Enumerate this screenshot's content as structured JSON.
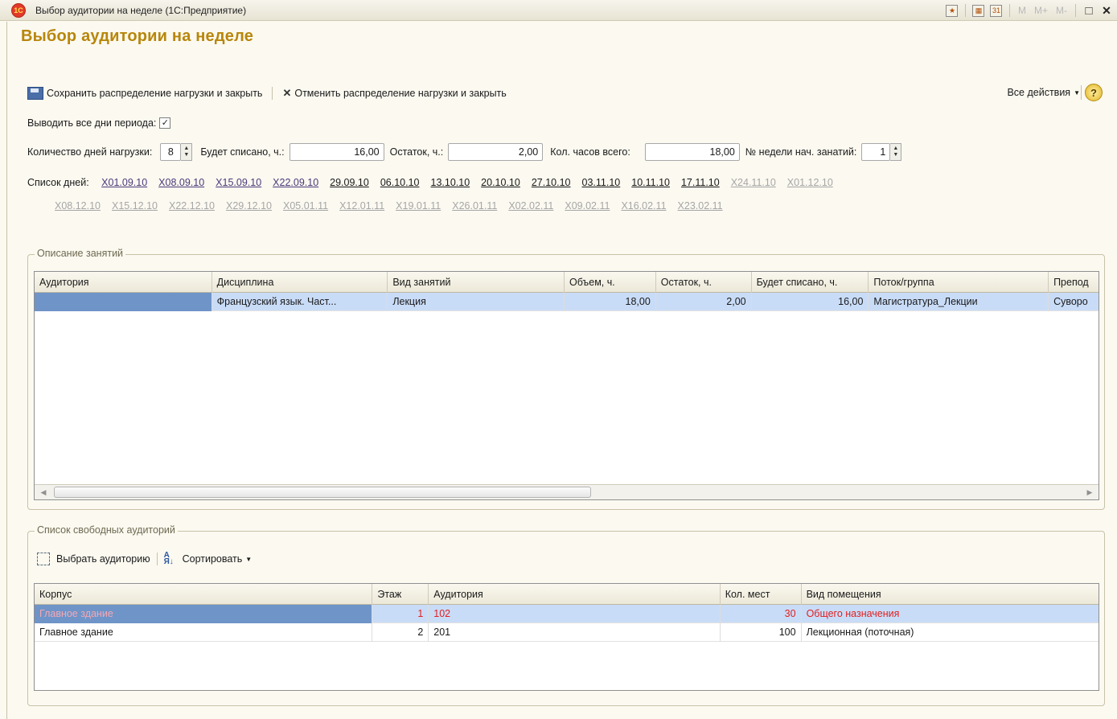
{
  "window": {
    "logo": "1C",
    "title": "Выбор аудитории на неделе  (1С:Предприятие)",
    "toolbar_m": "M",
    "toolbar_mplus": "M+",
    "toolbar_mminus": "M-",
    "close": "✕",
    "maximize": "□"
  },
  "form": {
    "title": "Выбор аудитории на неделе",
    "save_label": "Сохранить распределение нагрузки и закрыть",
    "cancel_label": "Отменить распределение нагрузки и закрыть",
    "all_actions": "Все действия",
    "help": "?"
  },
  "params": {
    "show_all_days_label": "Выводить все дни периода:",
    "show_all_days_checked": true,
    "days_count_label": "Количество дней нагрузки:",
    "days_count_value": "8",
    "will_write_label": "Будет списано, ч.:",
    "will_write_value": "16,00",
    "remainder_label": "Остаток, ч.:",
    "remainder_value": "2,00",
    "total_hours_label": "Кол. часов всего:",
    "total_hours_value": "18,00",
    "start_week_label": "№ недели нач. занатий:",
    "start_week_value": "1"
  },
  "days": {
    "label": "Список дней:",
    "line1": [
      {
        "text": "X01.09.10",
        "kind": "x"
      },
      {
        "text": "X08.09.10",
        "kind": "x"
      },
      {
        "text": "X15.09.10",
        "kind": "x"
      },
      {
        "text": "X22.09.10",
        "kind": "x"
      },
      {
        "text": "29.09.10",
        "kind": "a"
      },
      {
        "text": "06.10.10",
        "kind": "a"
      },
      {
        "text": "13.10.10",
        "kind": "a"
      },
      {
        "text": "20.10.10",
        "kind": "a"
      },
      {
        "text": "27.10.10",
        "kind": "a"
      },
      {
        "text": "03.11.10",
        "kind": "a"
      },
      {
        "text": "10.11.10",
        "kind": "a"
      },
      {
        "text": "17.11.10",
        "kind": "a"
      },
      {
        "text": "X24.11.10",
        "kind": "g"
      },
      {
        "text": "X01.12.10",
        "kind": "g"
      }
    ],
    "line2": [
      {
        "text": "X08.12.10",
        "kind": "g"
      },
      {
        "text": "X15.12.10",
        "kind": "g"
      },
      {
        "text": "X22.12.10",
        "kind": "g"
      },
      {
        "text": "X29.12.10",
        "kind": "g"
      },
      {
        "text": "X05.01.11",
        "kind": "g"
      },
      {
        "text": "X12.01.11",
        "kind": "g"
      },
      {
        "text": "X19.01.11",
        "kind": "g"
      },
      {
        "text": "X26.01.11",
        "kind": "g"
      },
      {
        "text": "X02.02.11",
        "kind": "g"
      },
      {
        "text": "X09.02.11",
        "kind": "g"
      },
      {
        "text": "X16.02.11",
        "kind": "g"
      },
      {
        "text": "X23.02.11",
        "kind": "g"
      }
    ]
  },
  "lessons": {
    "group_title": "Описание занятий",
    "columns": [
      "Аудитория",
      "Дисциплина",
      "Вид занятий",
      "Объем, ч.",
      "Остаток, ч.",
      "Будет списано, ч.",
      "Поток/группа",
      "Препод"
    ],
    "rows": [
      [
        "",
        "Французский язык. Част...",
        "Лекция",
        "18,00",
        "2,00",
        "16,00",
        "Магистратура_Лекции",
        "Суворо"
      ]
    ]
  },
  "rooms": {
    "group_title": "Список свободных аудиторий",
    "pick_label": "Выбрать аудиторию",
    "sort_label": "Сортировать",
    "columns": [
      "Корпус",
      "Этаж",
      "Аудитория",
      "Кол. мест",
      "Вид помещения"
    ],
    "rows": [
      [
        "Главное здание",
        "1",
        "102",
        "30",
        "Общего назначения"
      ],
      [
        "Главное здание",
        "2",
        "201",
        "100",
        "Лекционная (поточная)"
      ]
    ]
  },
  "colors": {
    "title_accent": "#b8860b",
    "selected_row": "#c9dcf7",
    "current_cell": "#6f94c8",
    "error_text": "#e02020"
  }
}
